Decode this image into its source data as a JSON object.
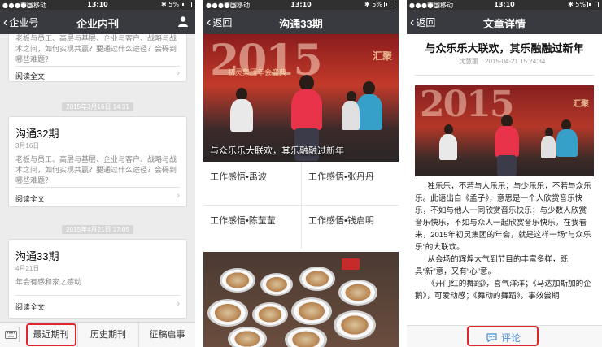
{
  "status_bar": {
    "carrier": "中国移动",
    "time": "13:10",
    "battery": "5%"
  },
  "screen1": {
    "back_label": "企业号",
    "title": "企业内刊",
    "cards": [
      {
        "title": "",
        "date": "",
        "desc": "老板与员工、高层与基层、企业与客户、战略与战术之间，如何实现共赢？要通过什么途径？会碍到哪些难题？",
        "read_more": "阅读全文"
      },
      {
        "title": "沟通32期",
        "date": "3月16日",
        "desc": "老板与员工、高层与基层、企业与客户、战略与战术之间，如何实现共赢？要通过什么途径？会碍到哪些难题？",
        "read_more": "阅读全文"
      },
      {
        "title": "沟通33期",
        "date": "4月21日",
        "desc": "年会有感和家之感动",
        "read_more": "阅读全文"
      }
    ],
    "timestamps": [
      "2015年3月16日 14:31",
      "2015年4月21日 17:05"
    ],
    "menu": [
      "最近期刊",
      "历史期刊",
      "征稿启事"
    ],
    "highlight_color": "#e0262b"
  },
  "screen2": {
    "back_label": "返回",
    "title": "沟通33期",
    "banner_text": "2015",
    "banner_sign": "汇聚",
    "banner_subsign": "初灵集团年会盛典",
    "banner_caption": "与众乐乐大联欢，其乐融融过新年",
    "articles": [
      "工作感悟•禹波",
      "工作感悟•张丹丹",
      "工作感悟•陈莹莹",
      "工作感悟•钱启明"
    ]
  },
  "screen3": {
    "back_label": "返回",
    "title": "文章详情",
    "article_title": "与众乐乐大联欢，其乐融融过新年",
    "author": "沈慧丽",
    "date": "2015-04-21 15:24:34",
    "image_text": "2015",
    "image_sign": "汇聚",
    "paragraphs": [
      "独乐乐，不若与人乐乐；与少乐乐，不若与众乐乐。此语出自《孟子》，意思是一个人欣赏音乐快乐，不如与他人一同欣赏音乐快乐；与少数人欣赏音乐快乐，不如与众人一起欣赏音乐快乐。在我看来，2015年初灵集团的年会，就是这样一场“与众乐乐”的大联欢。",
      "从会场的辉煌大气到节目的丰富多样，既具“新”意，又有“心”意。",
      "《开门红的舞蹈》，喜气洋洋；《马达加斯加的企鹅》，可爱动感；《舞动的舞蹈》，事效尝期"
    ],
    "comment_label": "评论"
  }
}
